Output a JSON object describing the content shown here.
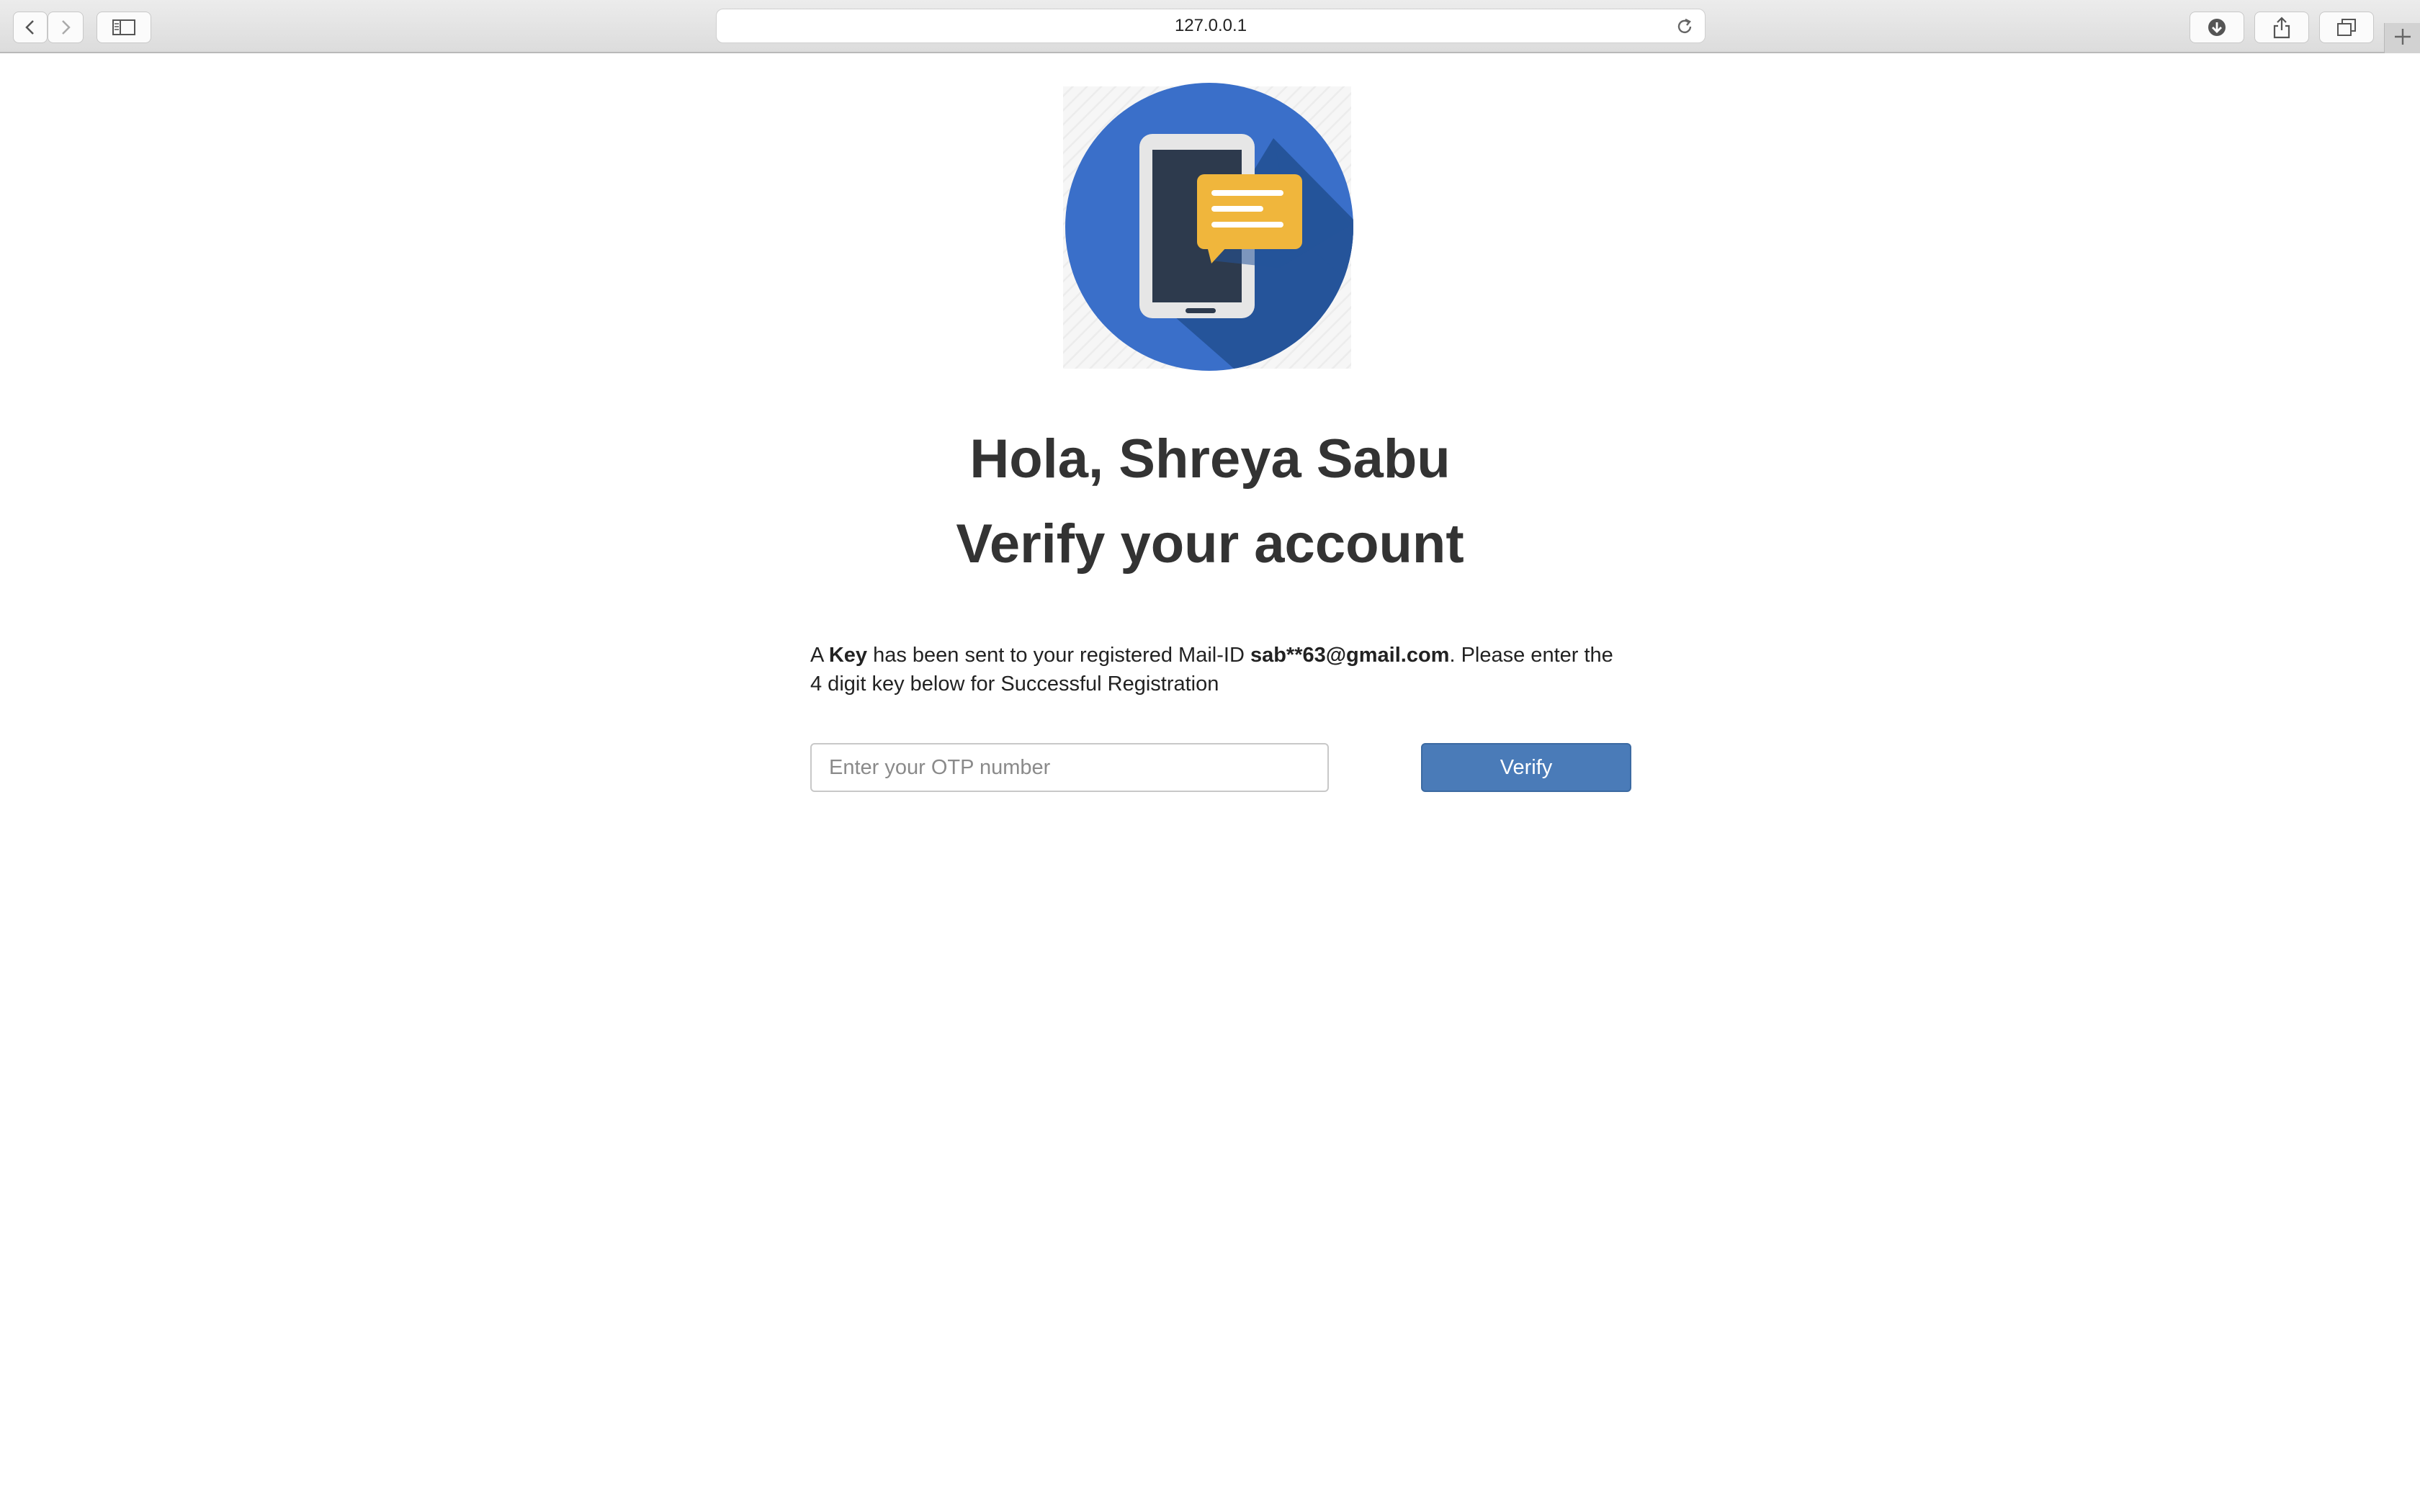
{
  "browser": {
    "url": "127.0.0.1",
    "icons": {
      "back": "chevron-left-icon",
      "forward": "chevron-right-icon",
      "sidebar": "sidebar-icon",
      "reload": "reload-icon",
      "downloads": "download-icon",
      "share": "share-icon",
      "tabs": "tabs-overview-icon",
      "new_tab": "plus-icon"
    }
  },
  "page": {
    "greeting": "Hola, Shreya Sabu",
    "heading": "Verify your account",
    "message": {
      "part1": "A ",
      "key_word": "Key",
      "part2": " has been sent to your registered Mail-ID ",
      "email": "sab**63@gmail.com",
      "part3": ". Please enter the 4 digit key below for Successful Registration"
    },
    "otp_placeholder": "Enter your OTP number",
    "otp_value": "",
    "verify_label": "Verify",
    "colors": {
      "logo_circle": "#3a6fc9",
      "phone_frame": "#e6e6e6",
      "phone_screen": "#2d3a4d",
      "chat_bubble": "#f0b63c",
      "button": "#4a7bb8"
    }
  }
}
